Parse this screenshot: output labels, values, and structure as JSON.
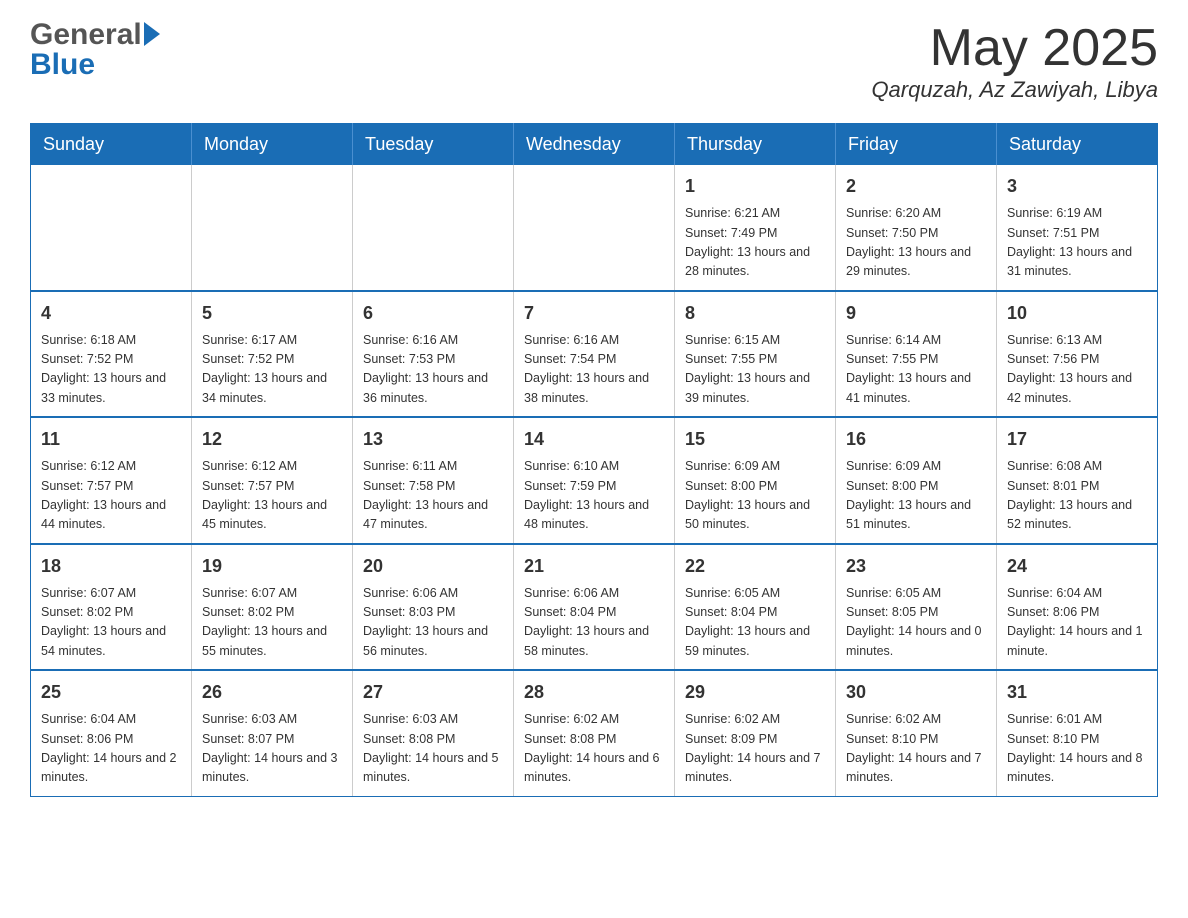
{
  "header": {
    "logo_general": "General",
    "logo_blue": "Blue",
    "month_title": "May 2025",
    "location": "Qarquzah, Az Zawiyah, Libya"
  },
  "weekdays": [
    "Sunday",
    "Monday",
    "Tuesday",
    "Wednesday",
    "Thursday",
    "Friday",
    "Saturday"
  ],
  "weeks": [
    [
      {
        "day": "",
        "sunrise": "",
        "sunset": "",
        "daylight": ""
      },
      {
        "day": "",
        "sunrise": "",
        "sunset": "",
        "daylight": ""
      },
      {
        "day": "",
        "sunrise": "",
        "sunset": "",
        "daylight": ""
      },
      {
        "day": "",
        "sunrise": "",
        "sunset": "",
        "daylight": ""
      },
      {
        "day": "1",
        "sunrise": "Sunrise: 6:21 AM",
        "sunset": "Sunset: 7:49 PM",
        "daylight": "Daylight: 13 hours and 28 minutes."
      },
      {
        "day": "2",
        "sunrise": "Sunrise: 6:20 AM",
        "sunset": "Sunset: 7:50 PM",
        "daylight": "Daylight: 13 hours and 29 minutes."
      },
      {
        "day": "3",
        "sunrise": "Sunrise: 6:19 AM",
        "sunset": "Sunset: 7:51 PM",
        "daylight": "Daylight: 13 hours and 31 minutes."
      }
    ],
    [
      {
        "day": "4",
        "sunrise": "Sunrise: 6:18 AM",
        "sunset": "Sunset: 7:52 PM",
        "daylight": "Daylight: 13 hours and 33 minutes."
      },
      {
        "day": "5",
        "sunrise": "Sunrise: 6:17 AM",
        "sunset": "Sunset: 7:52 PM",
        "daylight": "Daylight: 13 hours and 34 minutes."
      },
      {
        "day": "6",
        "sunrise": "Sunrise: 6:16 AM",
        "sunset": "Sunset: 7:53 PM",
        "daylight": "Daylight: 13 hours and 36 minutes."
      },
      {
        "day": "7",
        "sunrise": "Sunrise: 6:16 AM",
        "sunset": "Sunset: 7:54 PM",
        "daylight": "Daylight: 13 hours and 38 minutes."
      },
      {
        "day": "8",
        "sunrise": "Sunrise: 6:15 AM",
        "sunset": "Sunset: 7:55 PM",
        "daylight": "Daylight: 13 hours and 39 minutes."
      },
      {
        "day": "9",
        "sunrise": "Sunrise: 6:14 AM",
        "sunset": "Sunset: 7:55 PM",
        "daylight": "Daylight: 13 hours and 41 minutes."
      },
      {
        "day": "10",
        "sunrise": "Sunrise: 6:13 AM",
        "sunset": "Sunset: 7:56 PM",
        "daylight": "Daylight: 13 hours and 42 minutes."
      }
    ],
    [
      {
        "day": "11",
        "sunrise": "Sunrise: 6:12 AM",
        "sunset": "Sunset: 7:57 PM",
        "daylight": "Daylight: 13 hours and 44 minutes."
      },
      {
        "day": "12",
        "sunrise": "Sunrise: 6:12 AM",
        "sunset": "Sunset: 7:57 PM",
        "daylight": "Daylight: 13 hours and 45 minutes."
      },
      {
        "day": "13",
        "sunrise": "Sunrise: 6:11 AM",
        "sunset": "Sunset: 7:58 PM",
        "daylight": "Daylight: 13 hours and 47 minutes."
      },
      {
        "day": "14",
        "sunrise": "Sunrise: 6:10 AM",
        "sunset": "Sunset: 7:59 PM",
        "daylight": "Daylight: 13 hours and 48 minutes."
      },
      {
        "day": "15",
        "sunrise": "Sunrise: 6:09 AM",
        "sunset": "Sunset: 8:00 PM",
        "daylight": "Daylight: 13 hours and 50 minutes."
      },
      {
        "day": "16",
        "sunrise": "Sunrise: 6:09 AM",
        "sunset": "Sunset: 8:00 PM",
        "daylight": "Daylight: 13 hours and 51 minutes."
      },
      {
        "day": "17",
        "sunrise": "Sunrise: 6:08 AM",
        "sunset": "Sunset: 8:01 PM",
        "daylight": "Daylight: 13 hours and 52 minutes."
      }
    ],
    [
      {
        "day": "18",
        "sunrise": "Sunrise: 6:07 AM",
        "sunset": "Sunset: 8:02 PM",
        "daylight": "Daylight: 13 hours and 54 minutes."
      },
      {
        "day": "19",
        "sunrise": "Sunrise: 6:07 AM",
        "sunset": "Sunset: 8:02 PM",
        "daylight": "Daylight: 13 hours and 55 minutes."
      },
      {
        "day": "20",
        "sunrise": "Sunrise: 6:06 AM",
        "sunset": "Sunset: 8:03 PM",
        "daylight": "Daylight: 13 hours and 56 minutes."
      },
      {
        "day": "21",
        "sunrise": "Sunrise: 6:06 AM",
        "sunset": "Sunset: 8:04 PM",
        "daylight": "Daylight: 13 hours and 58 minutes."
      },
      {
        "day": "22",
        "sunrise": "Sunrise: 6:05 AM",
        "sunset": "Sunset: 8:04 PM",
        "daylight": "Daylight: 13 hours and 59 minutes."
      },
      {
        "day": "23",
        "sunrise": "Sunrise: 6:05 AM",
        "sunset": "Sunset: 8:05 PM",
        "daylight": "Daylight: 14 hours and 0 minutes."
      },
      {
        "day": "24",
        "sunrise": "Sunrise: 6:04 AM",
        "sunset": "Sunset: 8:06 PM",
        "daylight": "Daylight: 14 hours and 1 minute."
      }
    ],
    [
      {
        "day": "25",
        "sunrise": "Sunrise: 6:04 AM",
        "sunset": "Sunset: 8:06 PM",
        "daylight": "Daylight: 14 hours and 2 minutes."
      },
      {
        "day": "26",
        "sunrise": "Sunrise: 6:03 AM",
        "sunset": "Sunset: 8:07 PM",
        "daylight": "Daylight: 14 hours and 3 minutes."
      },
      {
        "day": "27",
        "sunrise": "Sunrise: 6:03 AM",
        "sunset": "Sunset: 8:08 PM",
        "daylight": "Daylight: 14 hours and 5 minutes."
      },
      {
        "day": "28",
        "sunrise": "Sunrise: 6:02 AM",
        "sunset": "Sunset: 8:08 PM",
        "daylight": "Daylight: 14 hours and 6 minutes."
      },
      {
        "day": "29",
        "sunrise": "Sunrise: 6:02 AM",
        "sunset": "Sunset: 8:09 PM",
        "daylight": "Daylight: 14 hours and 7 minutes."
      },
      {
        "day": "30",
        "sunrise": "Sunrise: 6:02 AM",
        "sunset": "Sunset: 8:10 PM",
        "daylight": "Daylight: 14 hours and 7 minutes."
      },
      {
        "day": "31",
        "sunrise": "Sunrise: 6:01 AM",
        "sunset": "Sunset: 8:10 PM",
        "daylight": "Daylight: 14 hours and 8 minutes."
      }
    ]
  ]
}
